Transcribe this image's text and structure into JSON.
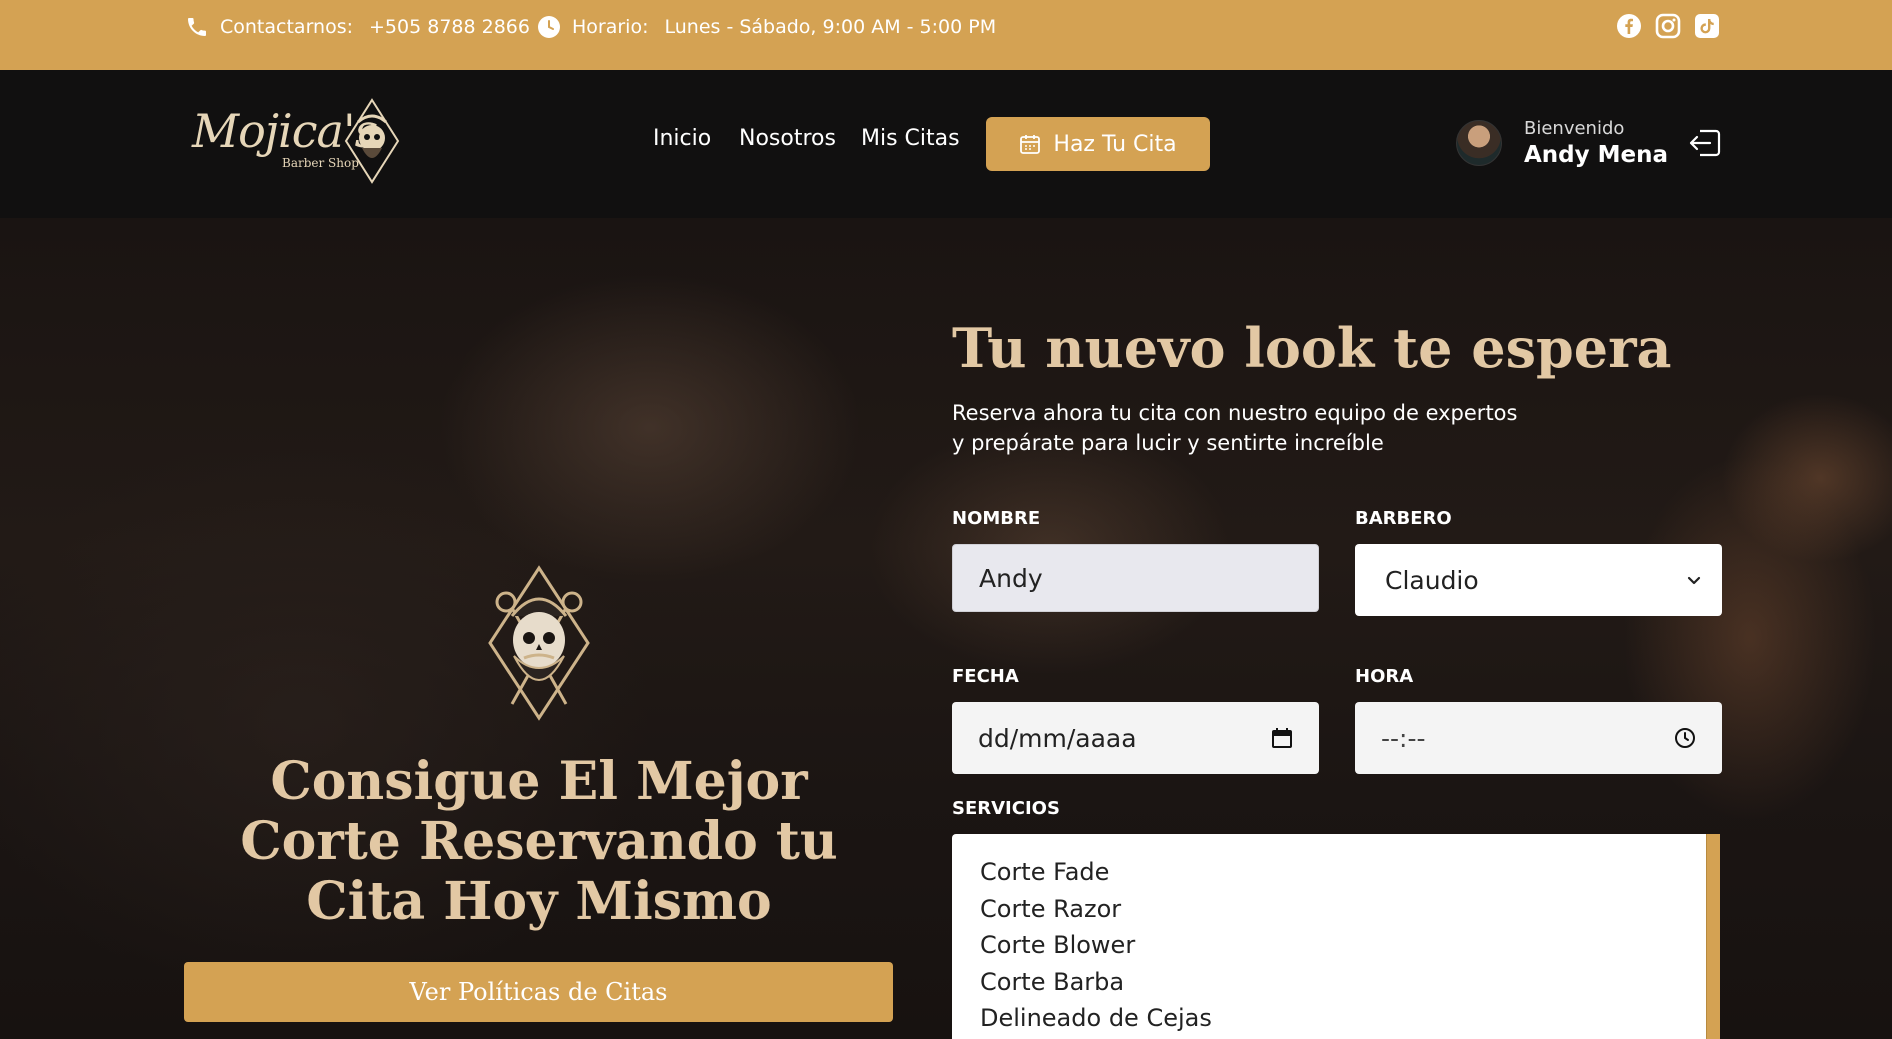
{
  "topbar": {
    "contact_label": "Contactarnos:",
    "contact_phone": "+505 8788 2866",
    "hours_label": "Horario:",
    "hours_value": "Lunes - Sábado, 9:00 AM - 5:00 PM",
    "social": [
      "facebook-icon",
      "instagram-icon",
      "tiktok-icon"
    ]
  },
  "nav": {
    "logo_text": "Mojica's",
    "logo_sub": "Barber Shop",
    "links": [
      "Inicio",
      "Nosotros",
      "Mis Citas"
    ],
    "cta": "Haz Tu Cita",
    "welcome": "Bienvenido",
    "user": "Andy Mena"
  },
  "hero": {
    "left_title": "Consigue El Mejor Corte Reservando tu Cita Hoy Mismo",
    "policy_button": "Ver Políticas de Citas",
    "right_title": "Tu nuevo look te espera",
    "desc_line1": "Reserva ahora tu cita con nuestro equipo de expertos",
    "desc_line2": "y prepárate para lucir y sentirte increíble"
  },
  "form": {
    "name_label": "NOMBRE",
    "name_value": "Andy",
    "barber_label": "BARBERO",
    "barber_value": "Claudio",
    "date_label": "FECHA",
    "date_placeholder": "dd/mm/aaaa",
    "time_label": "HORA",
    "time_placeholder": "--:--",
    "services_label": "SERVICIOS",
    "services": [
      "Corte Fade",
      "Corte Razor",
      "Corte Blower",
      "Corte Barba",
      "Delineado de Cejas"
    ]
  },
  "colors": {
    "accent": "#d4a253",
    "dark": "#111010",
    "gold_text": "#e2c8a4"
  }
}
